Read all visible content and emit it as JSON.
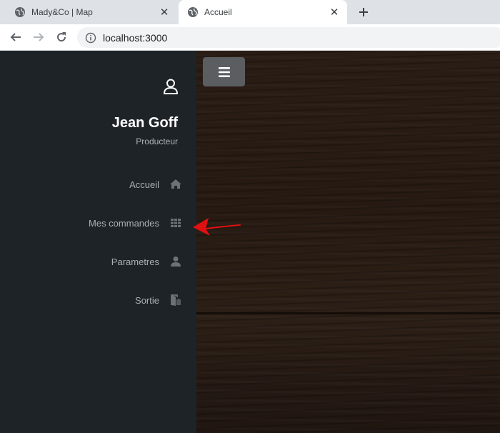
{
  "browser": {
    "tabs": [
      {
        "title": "Mady&Co | Map",
        "icon": "globe-icon",
        "active": false
      },
      {
        "title": "Accueil",
        "icon": "globe-icon",
        "active": true
      }
    ],
    "new_tab_icon": "plus-icon",
    "address": "localhost:3000",
    "nav_icons": [
      "back-arrow-icon",
      "forward-arrow-icon",
      "reload-icon",
      "info-icon"
    ]
  },
  "sidebar": {
    "user_icon": "user-icon",
    "user_name": "Jean Goff",
    "user_role": "Producteur",
    "items": [
      {
        "label": "Accueil",
        "icon": "home-icon"
      },
      {
        "label": "Mes commandes",
        "icon": "grid-icon"
      },
      {
        "label": "Parametres",
        "icon": "person-icon"
      },
      {
        "label": "Sortie",
        "icon": "door-exit-icon"
      }
    ]
  },
  "main": {
    "menu_toggle_icon": "hamburger-icon"
  },
  "annotation": {
    "arrow_color": "#e01010",
    "points_to": "Mes commandes"
  },
  "colors": {
    "sidebar_bg": "#1e2327",
    "toggle_bg": "#5b5e61",
    "wood_dark": "#2a1d15"
  }
}
